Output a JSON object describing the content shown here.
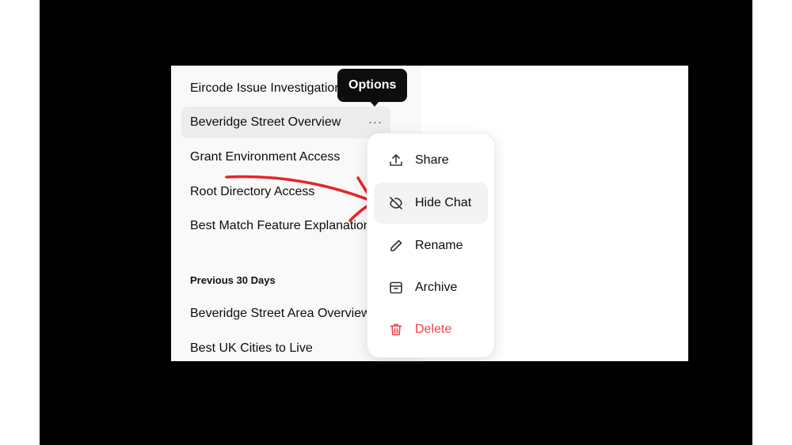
{
  "sidebar": {
    "items_today": [
      {
        "label": "Eircode Issue Investigation"
      },
      {
        "label": "Beveridge Street Overview",
        "more_label": "···"
      },
      {
        "label": "Grant Environment Access"
      },
      {
        "label": "Root Directory Access"
      },
      {
        "label": "Best Match Feature Explanation"
      }
    ],
    "section_label": "Previous 30 Days",
    "items_previous": [
      {
        "label": "Beveridge Street Area Overview"
      },
      {
        "label": "Best UK Cities to Live"
      }
    ]
  },
  "tooltip": {
    "label": "Options"
  },
  "context_menu": {
    "items": [
      {
        "label": "Share",
        "icon": "share-icon"
      },
      {
        "label": "Hide Chat",
        "icon": "hide-icon"
      },
      {
        "label": "Rename",
        "icon": "pencil-icon"
      },
      {
        "label": "Archive",
        "icon": "archive-icon"
      },
      {
        "label": "Delete",
        "icon": "trash-icon"
      }
    ]
  },
  "colors": {
    "delete": "#ef4146",
    "annotation_arrow": "#e8242b",
    "tooltip_bg": "#0d0d0d",
    "active_item_bg": "#ececec"
  }
}
